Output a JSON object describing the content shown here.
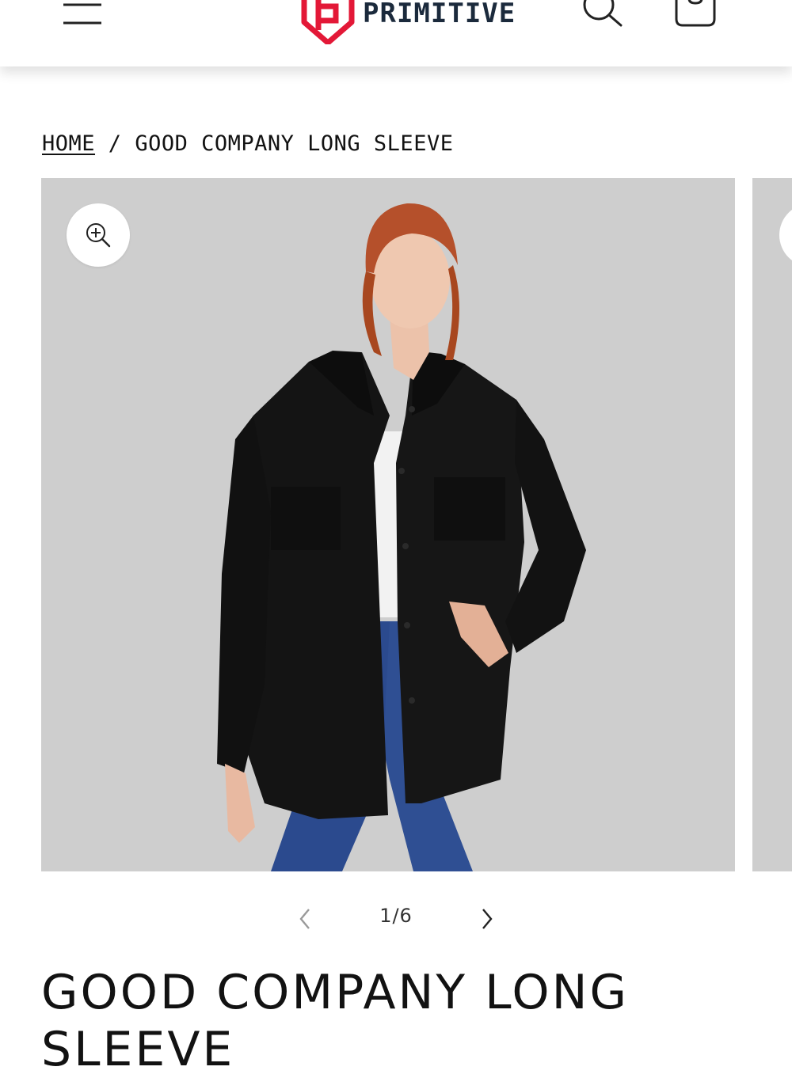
{
  "header": {
    "brand_name": "PRIMITIVE",
    "brand_color": "#e31837",
    "brand_text_color": "#1b2a3c",
    "icons": [
      "menu-icon",
      "search-icon",
      "cart-icon"
    ]
  },
  "breadcrumb": {
    "home_label": "HOME",
    "separator": "/",
    "current_label": "GOOD COMPANY LONG SLEEVE"
  },
  "gallery": {
    "background_color": "#cecece",
    "zoom_icon": "zoom-in-icon",
    "current_index": 1,
    "total": 6,
    "counter_text": "1/6"
  },
  "product": {
    "title": "GOOD COMPANY LONG SLEEVE"
  }
}
